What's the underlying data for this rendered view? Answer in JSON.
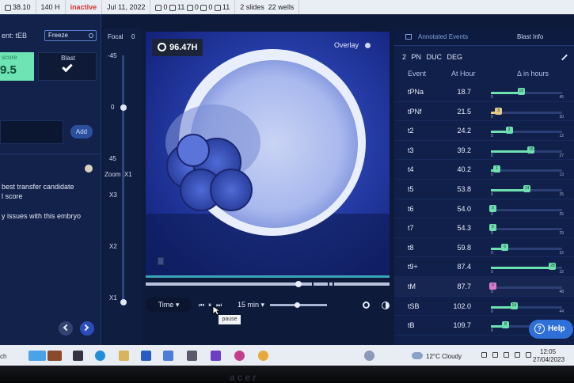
{
  "topbar": {
    "score": "38.10",
    "hours": "140 H",
    "status": "inactive",
    "date": "Jul 11, 2022",
    "counts": [
      "0",
      "11",
      "0",
      "0",
      "11"
    ],
    "slides": "2 slides",
    "wells": "22 wells"
  },
  "left": {
    "event_label": "ent: tEB",
    "freeze_label": "Freeze",
    "score_label": "score",
    "score_value": "9.5",
    "blast_label": "Blast",
    "add_label": "Add",
    "note1_line1": "best transfer candidate",
    "note1_line2": "l score",
    "note2": "y issues with this embryo"
  },
  "focal": {
    "label": "Focal",
    "value": "0",
    "ticks": [
      "-45",
      "0",
      "45"
    ],
    "zoom_label": "Zoom",
    "zoom_value": "X1",
    "zoom_ticks": [
      "X3",
      "X2",
      "X1"
    ]
  },
  "viewer": {
    "time": "96.47H",
    "overlay_label": "Overlay"
  },
  "controls": {
    "time_label": "Time",
    "interval": "15 min",
    "tooltip": "pause"
  },
  "right": {
    "tab_annotated": "Annotated Events",
    "tab_blast": "Blast Info",
    "tags": "2 PN  DUC  DEG",
    "col_event": "Event",
    "col_hour": "At Hour",
    "col_delta": "Δ in hours",
    "rows": [
      {
        "event": "tPNa",
        "hour": "18.7",
        "delta": "19",
        "min": "0",
        "max": "45",
        "pos": 0.42,
        "color": "#6fe0b0"
      },
      {
        "event": "tPNf",
        "hour": "21.5",
        "delta": "3",
        "min": "0",
        "max": "30",
        "pos": 0.1,
        "color": "#e8c98a"
      },
      {
        "event": "t2",
        "hour": "24.2",
        "delta": "3",
        "min": "0",
        "max": "12",
        "pos": 0.25,
        "color": "#6fe0b0"
      },
      {
        "event": "t3",
        "hour": "39.2",
        "delta": "15",
        "min": "0",
        "max": "27",
        "pos": 0.56,
        "color": "#6fe0b0"
      },
      {
        "event": "t4",
        "hour": "40.2",
        "delta": "1",
        "min": "0",
        "max": "13",
        "pos": 0.08,
        "color": "#6fe0b0"
      },
      {
        "event": "t5",
        "hour": "53.8",
        "delta": "14",
        "min": "0",
        "max": "25",
        "pos": 0.5,
        "color": "#6fe0b0"
      },
      {
        "event": "t6",
        "hour": "54.0",
        "delta": "0",
        "min": "0",
        "max": "25",
        "pos": 0.02,
        "color": "#6fe0b0"
      },
      {
        "event": "t7",
        "hour": "54.3",
        "delta": "0",
        "min": "0",
        "max": "29",
        "pos": 0.02,
        "color": "#6fe0b0"
      },
      {
        "event": "t8",
        "hour": "59.8",
        "delta": "6",
        "min": "0",
        "max": "32",
        "pos": 0.19,
        "color": "#6fe0b0"
      },
      {
        "event": "t9+",
        "hour": "87.4",
        "delta": "28",
        "min": "0",
        "max": "32",
        "pos": 0.86,
        "color": "#6fe0b0"
      },
      {
        "event": "tM",
        "hour": "87.7",
        "delta": "0",
        "min": "0",
        "max": "48",
        "pos": 0.02,
        "color": "#e07ad0",
        "highlight": true
      },
      {
        "event": "tSB",
        "hour": "102.0",
        "delta": "14",
        "min": "0",
        "max": "44",
        "pos": 0.32,
        "color": "#6fe0b0"
      },
      {
        "event": "tB",
        "hour": "109.7",
        "delta": "8",
        "min": "0",
        "max": "",
        "pos": 0.2,
        "color": "#6fe0b0"
      }
    ],
    "help_label": "Help"
  },
  "taskbar": {
    "search": "ch",
    "weather": "12°C  Cloudy",
    "time": "12:05",
    "date": "27/04/2023"
  },
  "bezel_brand": "acer"
}
